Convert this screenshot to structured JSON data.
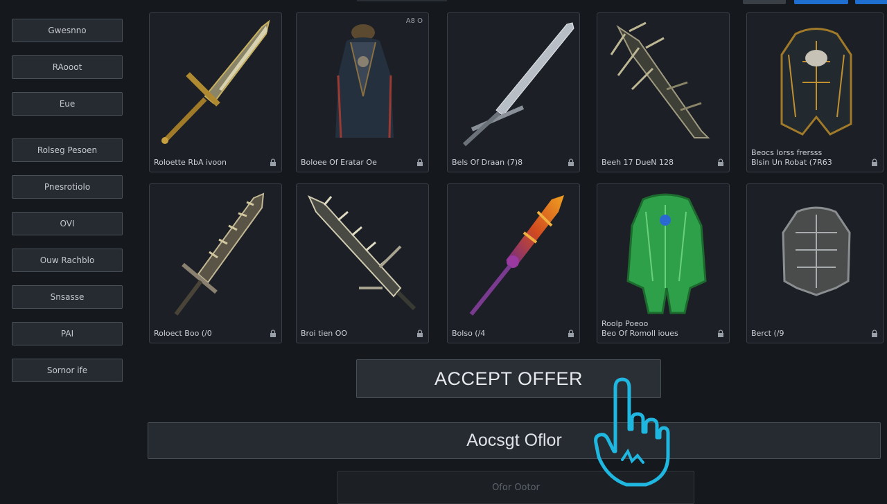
{
  "sidebar": {
    "items": [
      {
        "label": "Gwesnno"
      },
      {
        "label": "RAooot"
      },
      {
        "label": "Eue"
      },
      {
        "label": "Rolseg Pesoen"
      },
      {
        "label": "Pnesrotiolo"
      },
      {
        "label": "OVI"
      },
      {
        "label": "Ouw Rachblo"
      },
      {
        "label": "Snsasse"
      },
      {
        "label": "PAI"
      },
      {
        "label": "Sornor ife"
      }
    ]
  },
  "grid": {
    "corner_label": "A8 O",
    "items": [
      {
        "label": "Roloette RbA ivoon",
        "icon": "golden-sword"
      },
      {
        "label": "Boloee Of Eratar Oe",
        "icon": "dark-robe-armor"
      },
      {
        "label": "Bels Of Draan (7)8",
        "icon": "steel-sword"
      },
      {
        "label": "Beeh 17 DueN 128",
        "icon": "thorned-blade"
      },
      {
        "label": "Beocs lorss  frersss\nBlsin Un Robat (7R63",
        "icon": "golden-armor"
      },
      {
        "label": "Roloect Boo (/0",
        "icon": "jagged-sword"
      },
      {
        "label": "Broi tien OO",
        "icon": "serrated-blade"
      },
      {
        "label": "Bolso (/4",
        "icon": "flame-sword"
      },
      {
        "label": "Roolp Poeoo\nBeo Of Romoll ioues",
        "icon": "green-armor"
      },
      {
        "label": "Berct (/9",
        "icon": "silver-armor"
      }
    ]
  },
  "actions": {
    "accept_primary": "ACCEPT OFFER",
    "accept_secondary": "Aocsgt Oflor",
    "faded": "Ofor Ootor"
  },
  "colors": {
    "background": "#15191e",
    "panel": "#262b31",
    "accent_blue": "#1f6fd0",
    "cursor": "#1fb6e0"
  }
}
